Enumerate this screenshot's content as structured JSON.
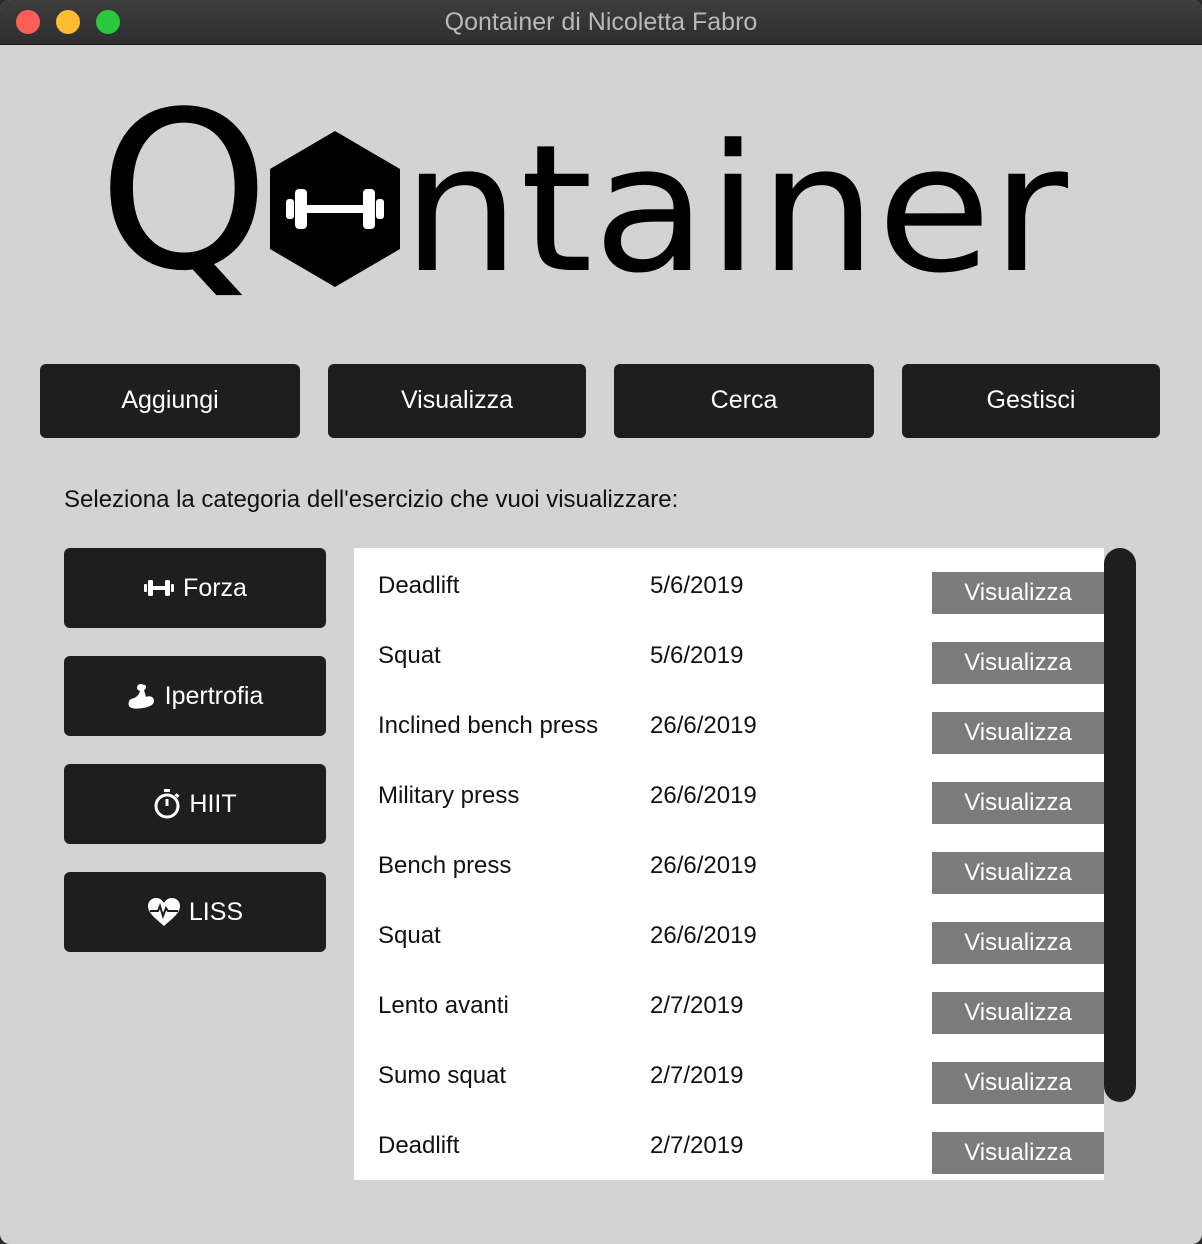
{
  "window": {
    "title": "Qontainer di Nicoletta Fabro"
  },
  "logo": {
    "text_q": "Q",
    "text_rest": "ntainer"
  },
  "toolbar": {
    "aggiungi": "Aggiungi",
    "visualizza": "Visualizza",
    "cerca": "Cerca",
    "gestisci": "Gestisci"
  },
  "prompt": "Seleziona la categoria dell'esercizio che vuoi visualizzare:",
  "categories": [
    {
      "label": "Forza",
      "icon": "dumbbell-icon"
    },
    {
      "label": "Ipertrofia",
      "icon": "flexed-biceps-icon"
    },
    {
      "label": "HIIT",
      "icon": "stopwatch-icon"
    },
    {
      "label": "LISS",
      "icon": "heart-pulse-icon"
    }
  ],
  "exercises": [
    {
      "name": "Deadlift",
      "date": "5/6/2019",
      "action": "Visualizza"
    },
    {
      "name": "Squat",
      "date": "5/6/2019",
      "action": "Visualizza"
    },
    {
      "name": "Inclined bench press",
      "date": "26/6/2019",
      "action": "Visualizza"
    },
    {
      "name": "Military press",
      "date": "26/6/2019",
      "action": "Visualizza"
    },
    {
      "name": "Bench press",
      "date": "26/6/2019",
      "action": "Visualizza"
    },
    {
      "name": "Squat",
      "date": "26/6/2019",
      "action": "Visualizza"
    },
    {
      "name": "Lento avanti",
      "date": "2/7/2019",
      "action": "Visualizza"
    },
    {
      "name": "Sumo squat",
      "date": "2/7/2019",
      "action": "Visualizza"
    },
    {
      "name": "Deadlift",
      "date": "2/7/2019",
      "action": "Visualizza"
    }
  ],
  "colors": {
    "window_bg": "#d4d3d4",
    "button_bg": "#1e1e1f",
    "row_button_bg": "#7b7b7c",
    "list_bg": "#ffffff"
  }
}
